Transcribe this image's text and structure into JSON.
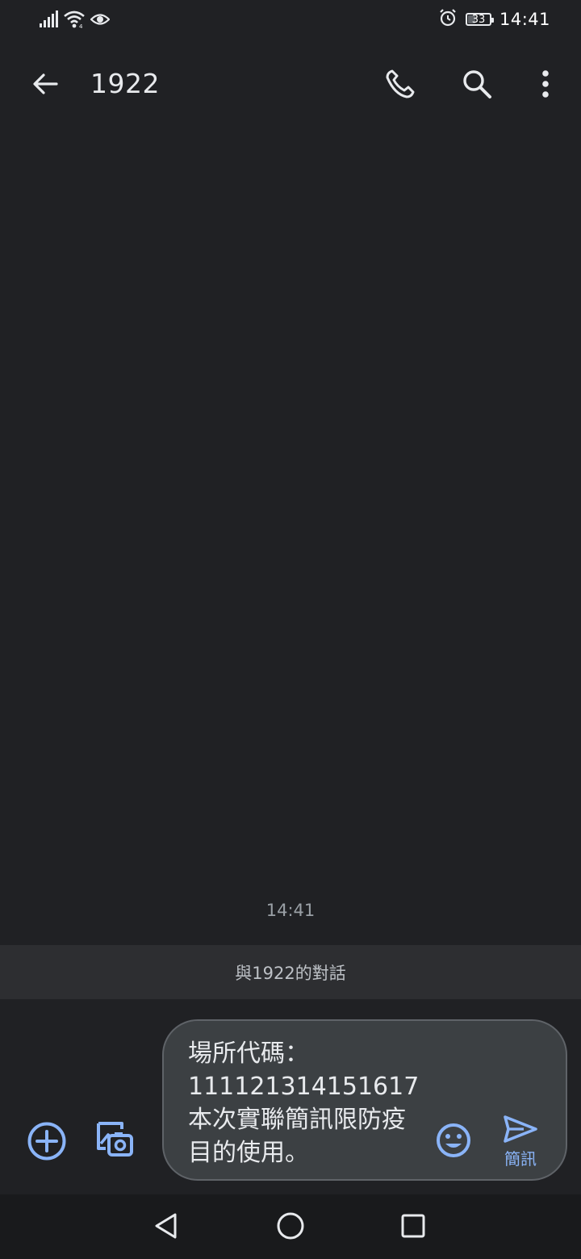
{
  "status_bar": {
    "time": "14:41",
    "battery_level": "33",
    "battery_fraction": 0.33,
    "icons": [
      "signal-icon",
      "wifi-icon",
      "eye-icon",
      "alarm-icon",
      "battery-icon"
    ]
  },
  "app_bar": {
    "title": "1922",
    "icons": [
      "back-arrow-icon",
      "phone-icon",
      "search-icon",
      "more-vert-icon"
    ]
  },
  "conversation": {
    "timestamp": "14:41",
    "banner_text": "與1922的對話"
  },
  "compose": {
    "draft_text": "場所代碼：\n111121314151617\n本次實聯簡訊限防疫目的使用。",
    "send_label": "簡訊",
    "icons": [
      "add-circle-icon",
      "gallery-icon",
      "emoji-icon",
      "send-icon"
    ]
  },
  "nav_bar": {
    "icons": [
      "nav-back-icon",
      "nav-home-icon",
      "nav-recents-icon"
    ]
  },
  "colors": {
    "background": "#202124",
    "accent": "#8ab4f8",
    "banner_bg": "#2d2e31",
    "compose_bg": "#3c4043"
  }
}
